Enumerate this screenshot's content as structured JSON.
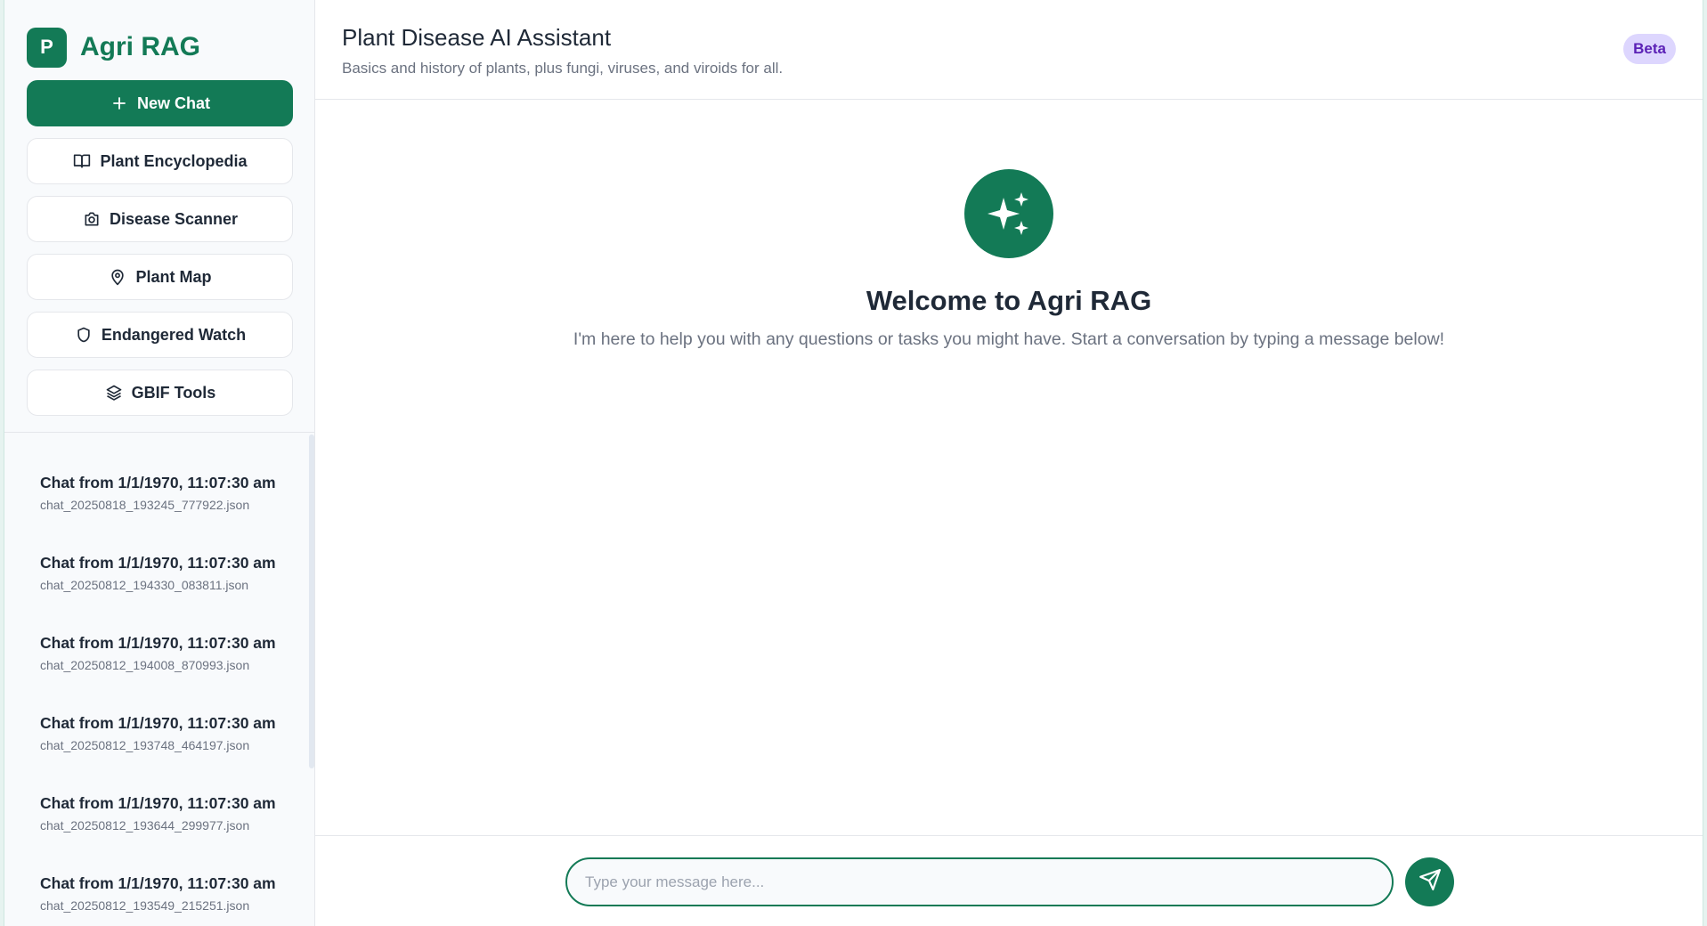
{
  "brand": {
    "logo_letter": "P",
    "name": "Agri RAG",
    "color": "#137a56"
  },
  "sidebar": {
    "buttons": [
      {
        "label": "New Chat",
        "icon": "plus-icon"
      },
      {
        "label": "Plant Encyclopedia",
        "icon": "book-open-icon"
      },
      {
        "label": "Disease Scanner",
        "icon": "camera-icon"
      },
      {
        "label": "Plant Map",
        "icon": "map-pin-icon"
      },
      {
        "label": "Endangered Watch",
        "icon": "shield-icon"
      },
      {
        "label": "GBIF Tools",
        "icon": "layers-icon"
      }
    ],
    "chats": [
      {
        "title": "Chat from 1/1/1970, 11:07:30 am",
        "file": "chat_20250818_193245_777922.json"
      },
      {
        "title": "Chat from 1/1/1970, 11:07:30 am",
        "file": "chat_20250812_194330_083811.json"
      },
      {
        "title": "Chat from 1/1/1970, 11:07:30 am",
        "file": "chat_20250812_194008_870993.json"
      },
      {
        "title": "Chat from 1/1/1970, 11:07:30 am",
        "file": "chat_20250812_193748_464197.json"
      },
      {
        "title": "Chat from 1/1/1970, 11:07:30 am",
        "file": "chat_20250812_193644_299977.json"
      },
      {
        "title": "Chat from 1/1/1970, 11:07:30 am",
        "file": "chat_20250812_193549_215251.json"
      }
    ]
  },
  "header": {
    "title": "Plant Disease AI Assistant",
    "subtitle": "Basics and history of plants, plus fungi, viruses, and viroids for all.",
    "badge": "Beta",
    "badge_color": "#ddd6fe"
  },
  "welcome": {
    "icon": "sparkles-icon",
    "title": "Welcome to Agri RAG",
    "text": "I'm here to help you with any questions or tasks you might have. Start a conversation by typing a message below!"
  },
  "composer": {
    "placeholder": "Type your message here...",
    "value": "",
    "send_icon": "send-icon"
  }
}
